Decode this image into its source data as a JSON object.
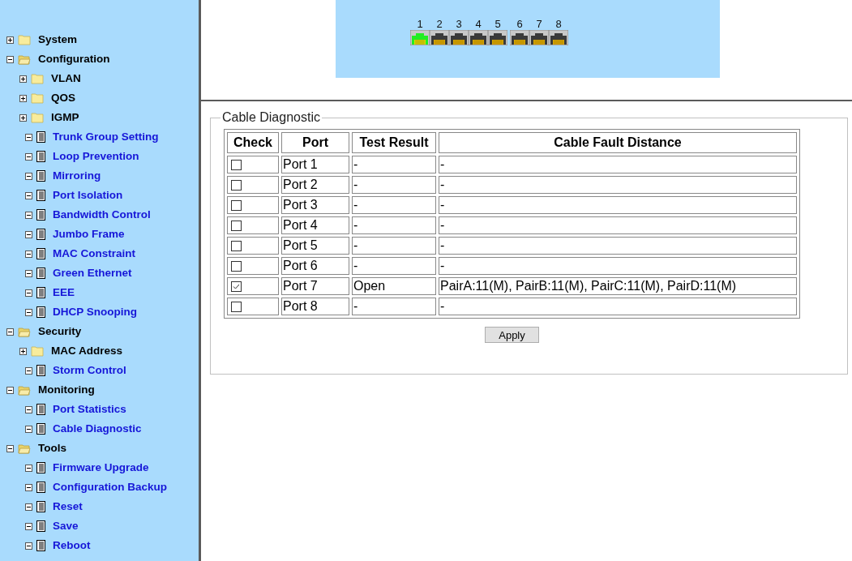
{
  "sidebar": {
    "tree": [
      {
        "label": "System",
        "kind": "folder",
        "expanded": false
      },
      {
        "label": "Configuration",
        "kind": "folder",
        "expanded": true,
        "children": [
          {
            "label": "VLAN",
            "kind": "folder",
            "expanded": false
          },
          {
            "label": "QOS",
            "kind": "folder",
            "expanded": false
          },
          {
            "label": "IGMP",
            "kind": "folder",
            "expanded": false
          },
          {
            "label": "Trunk Group Setting",
            "kind": "page"
          },
          {
            "label": "Loop Prevention",
            "kind": "page"
          },
          {
            "label": "Mirroring",
            "kind": "page"
          },
          {
            "label": "Port Isolation",
            "kind": "page"
          },
          {
            "label": "Bandwidth Control",
            "kind": "page"
          },
          {
            "label": "Jumbo Frame",
            "kind": "page"
          },
          {
            "label": "MAC Constraint",
            "kind": "page"
          },
          {
            "label": "Green Ethernet",
            "kind": "page"
          },
          {
            "label": "EEE",
            "kind": "page"
          },
          {
            "label": "DHCP Snooping",
            "kind": "page"
          }
        ]
      },
      {
        "label": "Security",
        "kind": "folder",
        "expanded": true,
        "children": [
          {
            "label": "MAC Address",
            "kind": "folder",
            "expanded": false
          },
          {
            "label": "Storm Control",
            "kind": "page"
          }
        ]
      },
      {
        "label": "Monitoring",
        "kind": "folder",
        "expanded": true,
        "children": [
          {
            "label": "Port Statistics",
            "kind": "page"
          },
          {
            "label": "Cable Diagnostic",
            "kind": "page"
          }
        ]
      },
      {
        "label": "Tools",
        "kind": "folder",
        "expanded": true,
        "children": [
          {
            "label": "Firmware Upgrade",
            "kind": "page"
          },
          {
            "label": "Configuration Backup",
            "kind": "page"
          },
          {
            "label": "Reset",
            "kind": "page"
          },
          {
            "label": "Save",
            "kind": "page"
          },
          {
            "label": "Reboot",
            "kind": "page"
          }
        ]
      }
    ]
  },
  "ports": [
    {
      "label": "1",
      "link": true
    },
    {
      "label": "2",
      "link": false
    },
    {
      "label": "3",
      "link": false
    },
    {
      "label": "4",
      "link": false
    },
    {
      "label": "5",
      "link": false
    },
    {
      "label": "6",
      "link": false
    },
    {
      "label": "7",
      "link": false
    },
    {
      "label": "8",
      "link": false
    }
  ],
  "cable_diagnostic": {
    "title": "Cable Diagnostic",
    "columns": [
      "Check",
      "Port",
      "Test Result",
      "Cable Fault Distance"
    ],
    "rows": [
      {
        "checked": false,
        "port": "Port 1",
        "test_result": "-",
        "cable_fault_distance": "-"
      },
      {
        "checked": false,
        "port": "Port 2",
        "test_result": "-",
        "cable_fault_distance": "-"
      },
      {
        "checked": false,
        "port": "Port 3",
        "test_result": "-",
        "cable_fault_distance": "-"
      },
      {
        "checked": false,
        "port": "Port 4",
        "test_result": "-",
        "cable_fault_distance": "-"
      },
      {
        "checked": false,
        "port": "Port 5",
        "test_result": "-",
        "cable_fault_distance": "-"
      },
      {
        "checked": false,
        "port": "Port 6",
        "test_result": "-",
        "cable_fault_distance": "-"
      },
      {
        "checked": true,
        "port": "Port 7",
        "test_result": "Open",
        "cable_fault_distance": "PairA:11(M), PairB:11(M), PairC:11(M), PairD:11(M)"
      },
      {
        "checked": false,
        "port": "Port 8",
        "test_result": "-",
        "cable_fault_distance": "-"
      }
    ],
    "apply_button": "Apply"
  }
}
